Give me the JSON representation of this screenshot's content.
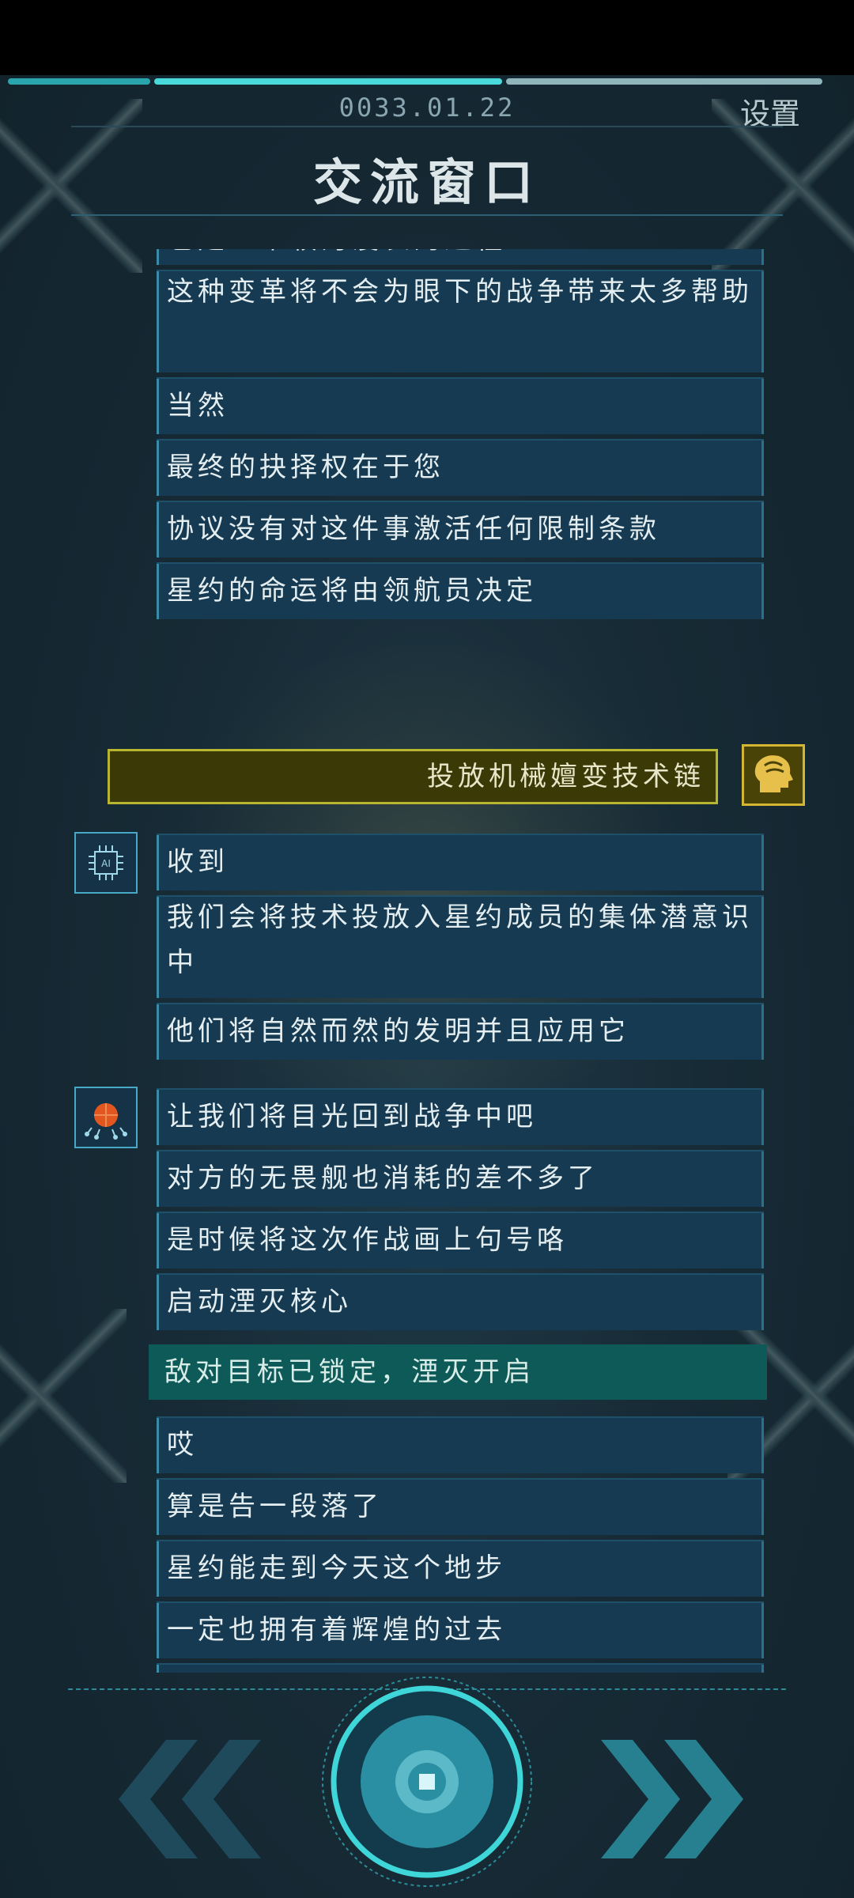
{
  "header": {
    "date": "0033.01.22",
    "settings_label": "设置",
    "title": "交流窗口"
  },
  "chat": {
    "cut_top_line": "也是一个较为漫长的过程",
    "block1": [
      "这种变革将不会为眼下的战争带来太多帮助",
      "当然",
      "最终的抉择权在于您",
      "协议没有对这件事激活任何限制条款",
      "星约的命运将由领航员决定"
    ],
    "player_choice": "投放机械嬗变技术链",
    "block2": [
      "收到",
      "我们会将技术投放入星约成员的集体潜意识中",
      "他们将自然而然的发明并且应用它"
    ],
    "block3": [
      "让我们将目光回到战争中吧",
      "对方的无畏舰也消耗的差不多了",
      "是时候将这次作战画上句号咯",
      "启动湮灭核心"
    ],
    "system_line": "敌对目标已锁定，湮灭开启",
    "block4": [
      "哎",
      "算是告一段落了",
      "星约能走到今天这个地步",
      "一定也拥有着辉煌的过去"
    ]
  },
  "icons": {
    "ai_chip": "ai-chip-icon",
    "ai_brain": "ai-brain-icon",
    "player": "player-head-icon",
    "prev": "double-chevron-left-icon",
    "next": "double-chevron-right-icon",
    "center": "center-action-icon"
  },
  "colors": {
    "accent": "#3fd6d9",
    "panel": "#163a52",
    "player_bg": "#3b3a07",
    "player_border": "#b8b530",
    "system_bg": "#0e5a58"
  }
}
